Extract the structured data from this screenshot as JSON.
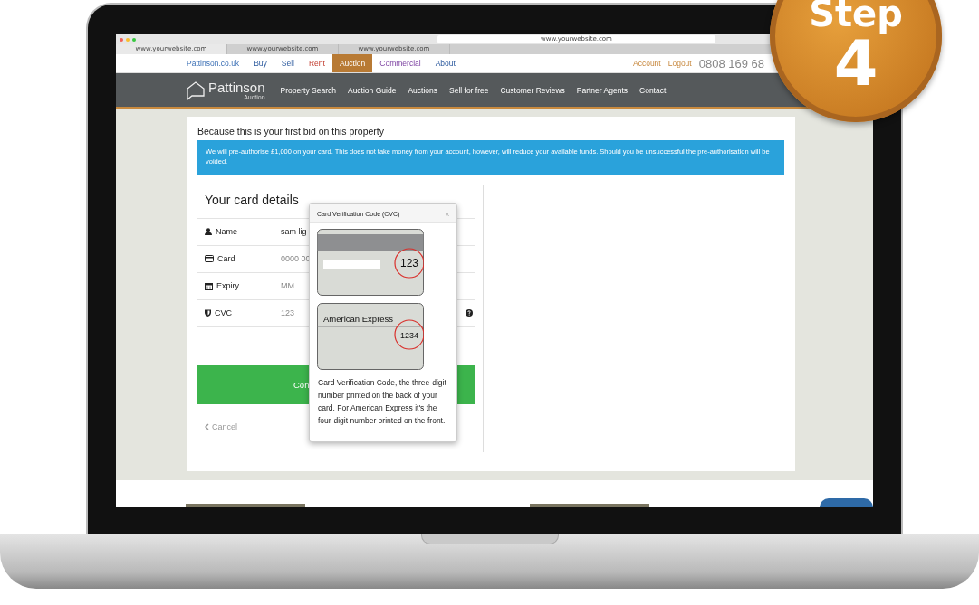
{
  "browser": {
    "url": "www.yourwebsite.com",
    "tabs": [
      {
        "label": "www.yourwebsite.com",
        "selected": true
      },
      {
        "label": "www.yourwebsite.com",
        "selected": false
      },
      {
        "label": "www.yourwebsite.com",
        "selected": false
      }
    ]
  },
  "top_nav": {
    "links": [
      {
        "label": "Pattinson.co.uk",
        "selected": false
      },
      {
        "label": "Buy",
        "selected": false
      },
      {
        "label": "Sell",
        "selected": false
      },
      {
        "label": "Rent",
        "selected": false
      },
      {
        "label": "Auction",
        "selected": true
      },
      {
        "label": "Commercial",
        "selected": false
      },
      {
        "label": "About",
        "selected": false
      }
    ],
    "account_links": [
      "Account",
      "Logout"
    ],
    "phone": "0808 169 68"
  },
  "main_nav": {
    "logo_name": "Pattinson",
    "logo_sub": "Auction",
    "items": [
      "Property Search",
      "Auction Guide",
      "Auctions",
      "Sell for free",
      "Customer Reviews",
      "Partner Agents",
      "Contact"
    ]
  },
  "card": {
    "heading": "Because this is your first bid on this property",
    "notice": "We will pre-authorise £1,000 on your card. This does not take money from your account, however, will reduce your available funds. Should you be unsuccessful the pre-authorisation will be voided.",
    "form": {
      "title": "Your card details",
      "fields": [
        {
          "kind": "person",
          "label": "Name",
          "value": "sam lig"
        },
        {
          "kind": "card",
          "label": "Card",
          "placeholder": "0000 00"
        },
        {
          "kind": "calendar",
          "label": "Expiry",
          "placeholder": "MM"
        },
        {
          "kind": "shield",
          "label": "CVC",
          "placeholder": "123"
        }
      ],
      "submit": "Con",
      "cancel": "Cancel"
    }
  },
  "popover": {
    "title": "Card Verification Code (CVC)",
    "close": "x",
    "back_code": "123",
    "front_brand": "American Express",
    "front_code": "1234",
    "text": "Card Verification Code, the three-digit number printed on the back of your card. For American Express it's the four-digit number printed on the front."
  },
  "badge": {
    "word": "Step",
    "number": "4"
  }
}
